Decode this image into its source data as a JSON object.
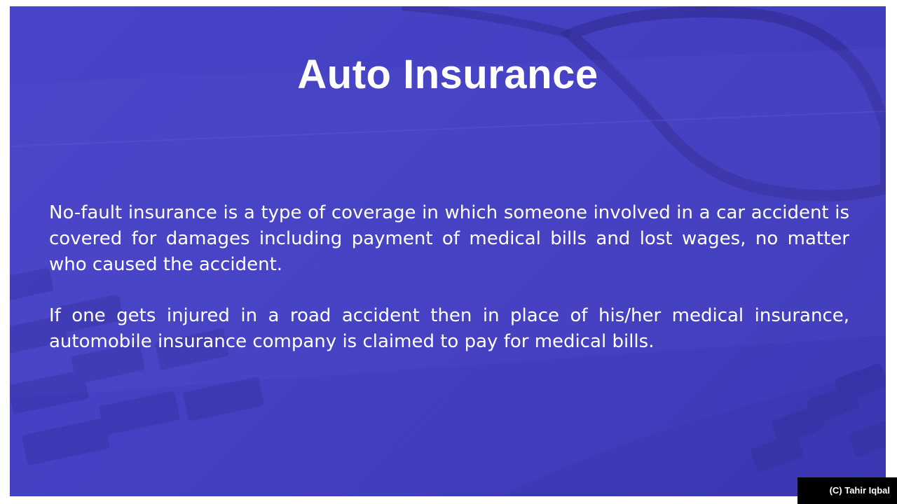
{
  "slide": {
    "title": "Auto Insurance",
    "paragraphs": [
      "No-fault insurance is a type of coverage in which someone involved in a car accident is covered for damages including payment of medical bills and lost wages, no matter who caused the accident.",
      "If one gets injured in a road accident then in place of his/her medical insurance, automobile insurance company is claimed to pay for medical bills."
    ],
    "background_color": "#4640c2"
  },
  "credit": {
    "label": "(C) Tahir Iqbal"
  }
}
